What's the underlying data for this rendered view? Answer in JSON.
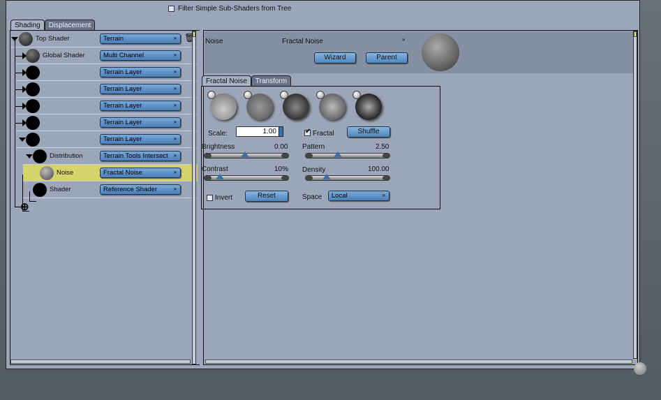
{
  "filter": {
    "label": "Filter Simple Sub-Shaders from Tree",
    "checked": false
  },
  "left_tabs": [
    {
      "label": "Shading",
      "active": true
    },
    {
      "label": "Displacement",
      "active": false
    }
  ],
  "tree": [
    {
      "label": "Top Shader",
      "type": "Terrain",
      "expanded": true
    },
    {
      "label": "Global Shader",
      "type": "Multi Channel",
      "expanded": false
    },
    {
      "label": "",
      "type": "Terrain Layer",
      "expanded": false
    },
    {
      "label": "",
      "type": "Terrain Layer",
      "expanded": false
    },
    {
      "label": "",
      "type": "Terrain Layer",
      "expanded": false
    },
    {
      "label": "",
      "type": "Terrain Layer",
      "expanded": false
    },
    {
      "label": "",
      "type": "Terrain Layer",
      "expanded": true
    },
    {
      "label": "Distribution",
      "type": "Terrain Tools Intersect",
      "expanded": true
    },
    {
      "label": "Noise",
      "type": "Fractal Noise",
      "selected": true
    },
    {
      "label": "Shader",
      "type": "Reference Shader"
    }
  ],
  "header": {
    "name": "Noise",
    "type": "Fractal Noise",
    "wizard": "Wizard",
    "parent": "Parent"
  },
  "right_tabs": [
    {
      "label": "Fractal Noise",
      "active": true
    },
    {
      "label": "Transform",
      "active": false
    }
  ],
  "params": {
    "scale_label": "Scale:",
    "scale_value": "1.00",
    "fractal_label": "Fractal",
    "fractal_checked": true,
    "shuffle": "Shuffle",
    "brightness": {
      "label": "Brightness",
      "value": "0.00",
      "position": 0.5
    },
    "pattern": {
      "label": "Pattern",
      "value": "2.50",
      "position": 0.38
    },
    "contrast": {
      "label": "Contrast",
      "value": "10%",
      "position": 0.14
    },
    "density": {
      "label": "Density",
      "value": "100.00",
      "position": 0.22
    },
    "invert_label": "Invert",
    "invert_checked": false,
    "reset": "Reset",
    "space_label": "Space",
    "space_value": "Local"
  },
  "colors": {
    "panel": "#9ca6b9",
    "button": "#5a8fc6",
    "selected_row": "#d4d46a"
  }
}
